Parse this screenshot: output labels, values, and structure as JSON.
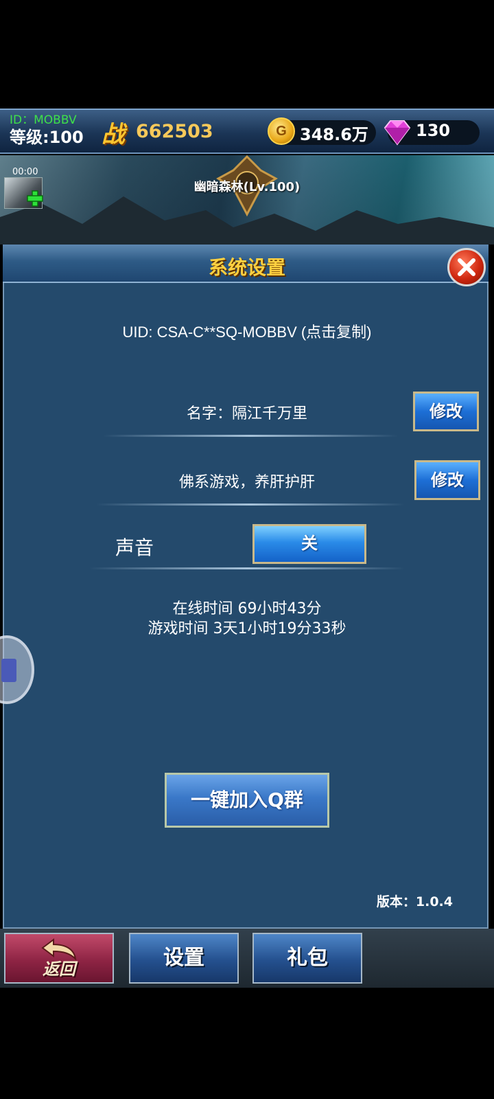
{
  "header": {
    "uid_short": "ID：MOBBV",
    "level": "等级:100",
    "power_icon_text": "战",
    "power": "662503",
    "gold_icon_text": "G",
    "gold": "348.6万",
    "gems": "130"
  },
  "scene": {
    "timer": "00:00",
    "map_name": "幽暗森林(Lv.100)"
  },
  "settings": {
    "title": "系统设置",
    "uid_text": "UID: CSA-C**SQ-MOBBV (点击复制)",
    "name_label": "名字：隔江千万里",
    "motto": "佛系游戏，养肝护肝",
    "edit_label": "修改",
    "sound_label": "声音",
    "sound_value": "关",
    "online_time": "在线时间 69小时43分",
    "game_time": "游戏时间 3天1小时19分33秒",
    "qq_button": "一键加入Q群",
    "version": "版本：1.0.4"
  },
  "nav": {
    "back": "返回",
    "settings": "设置",
    "gift": "礼包"
  },
  "colors": {
    "panel_bg": "#244a6c",
    "title_gold": "#ffd040",
    "uid_green": "#3ee04a",
    "power_gold": "#f7c95a"
  }
}
